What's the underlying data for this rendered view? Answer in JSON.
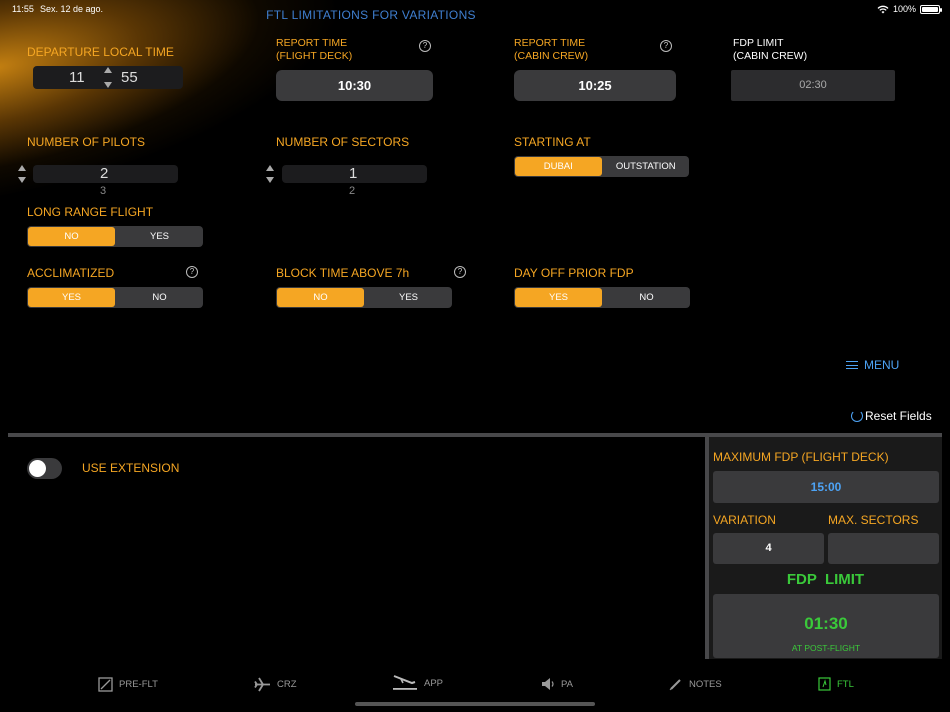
{
  "status_bar": {
    "time": "11:55",
    "date": "Sex. 12 de ago.",
    "battery": "100%"
  },
  "title": "FTL LIMITATIONS FOR VARIATIONS",
  "departure": {
    "label": "DEPARTURE LOCAL TIME",
    "hour": "11",
    "minute": "55"
  },
  "report_fd": {
    "label_1": "REPORT TIME",
    "label_2": "(FLIGHT DECK)",
    "value": "10:30"
  },
  "report_cc": {
    "label_1": "REPORT TIME",
    "label_2": "(CABIN CREW)",
    "value": "10:25"
  },
  "fdp_limit_top": {
    "label_1": "FDP LIMIT",
    "label_2": "(CABIN CREW)",
    "value": "02:30"
  },
  "pilots": {
    "label": "NUMBER OF PILOTS",
    "value": "2",
    "next": "3"
  },
  "sectors": {
    "label": "NUMBER OF SECTORS",
    "value": "1",
    "next": "2"
  },
  "starting": {
    "label": "STARTING AT",
    "options": [
      "DUBAI",
      "OUTSTATION"
    ],
    "selected": "DUBAI"
  },
  "long_range": {
    "label": "LONG RANGE FLIGHT",
    "options": [
      "NO",
      "YES"
    ],
    "selected": "NO"
  },
  "acclimatized": {
    "label": "ACCLIMATIZED",
    "options": [
      "YES",
      "NO"
    ],
    "selected": "YES"
  },
  "block_time": {
    "label": "BLOCK TIME ABOVE 7h",
    "options": [
      "NO",
      "YES"
    ],
    "selected": "NO"
  },
  "day_off": {
    "label": "DAY OFF PRIOR FDP",
    "options": [
      "YES",
      "NO"
    ],
    "selected": "YES"
  },
  "help_glyph": "?",
  "menu_label": "MENU",
  "reset_label": "Reset Fields",
  "extension": {
    "label": "USE EXTENSION",
    "enabled": false
  },
  "panel": {
    "max_fdp_label": "MAXIMUM FDP (FLIGHT DECK)",
    "max_fdp_value": "15:00",
    "variation_label": "VARIATION",
    "variation_value": "4",
    "max_sectors_label": "MAX. SECTORS",
    "max_sectors_value": "",
    "fdp_limit_label": "FDP  LIMIT",
    "fdp_limit_value": "01:30",
    "fdp_limit_sub": "AT POST-FLIGHT"
  },
  "tabs": [
    {
      "label": "PRE-FLT",
      "icon": "checkbox-icon"
    },
    {
      "label": "CRZ",
      "icon": "airplane-icon"
    },
    {
      "label": "APP",
      "icon": "landing-icon"
    },
    {
      "label": "PA",
      "icon": "speaker-icon"
    },
    {
      "label": "NOTES",
      "icon": "pencil-icon"
    },
    {
      "label": "FTL",
      "icon": "ftl-icon"
    }
  ],
  "active_tab": "FTL",
  "colors": {
    "accent": "#f5a623",
    "link": "#4da3f5",
    "green": "#3ac93a",
    "title": "#3f7fd0"
  }
}
